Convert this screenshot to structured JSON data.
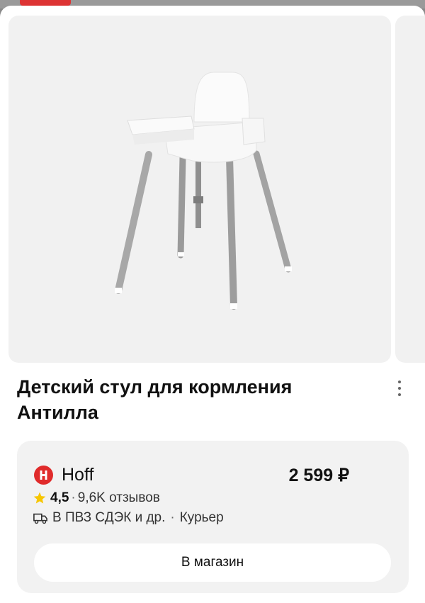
{
  "product": {
    "title": "Детский стул для кормления Антилла"
  },
  "offer": {
    "shop_name": "Hoff",
    "shop_logo_letter": "Н",
    "price": "2 599 ₽",
    "rating": "4,5",
    "reviews": "9,6K отзывов",
    "delivery_pickup": "В ПВЗ СДЭК и др.",
    "delivery_courier": "Курьер",
    "button_label": "В магазин"
  },
  "colors": {
    "shop_logo": "#e02b2b",
    "star": "#f7c600",
    "card_bg": "#f2f2f2"
  },
  "icons": {
    "more": "more-vertical-icon",
    "star": "star-icon",
    "delivery": "delivery-truck-icon"
  }
}
